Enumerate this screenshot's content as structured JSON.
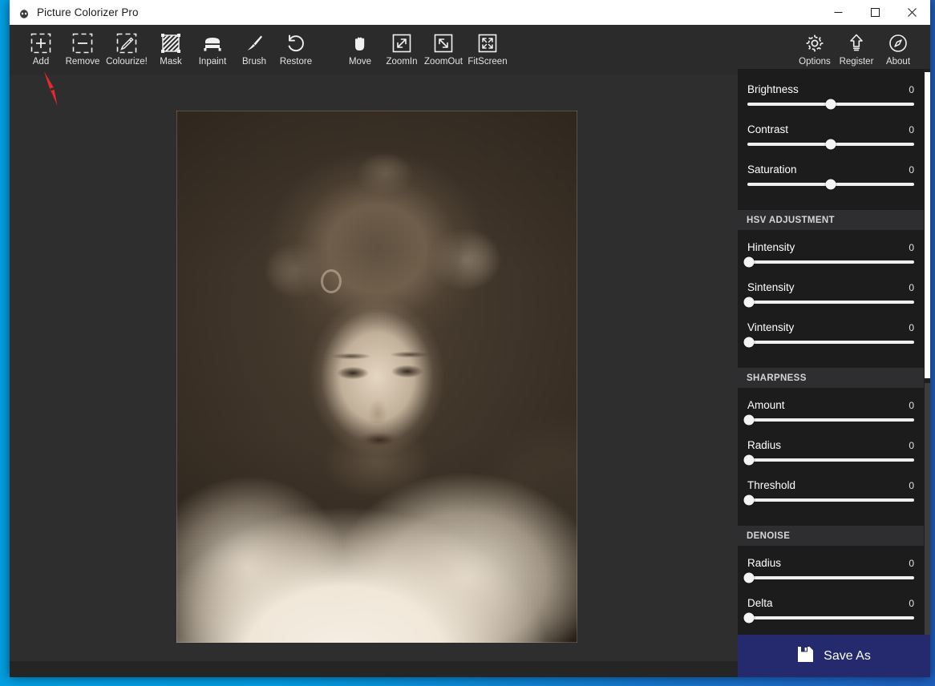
{
  "window": {
    "title": "Picture Colorizer Pro",
    "app_icon": "app-logo-icon",
    "controls": {
      "minimize": "minimize-icon",
      "maximize": "maximize-icon",
      "close": "close-icon"
    }
  },
  "toolbar": {
    "left_group": [
      {
        "label": "Add",
        "icon": "add-icon"
      },
      {
        "label": "Remove",
        "icon": "remove-icon"
      },
      {
        "label": "Colourize!",
        "icon": "colourize-icon"
      },
      {
        "label": "Mask",
        "icon": "mask-icon"
      },
      {
        "label": "Inpaint",
        "icon": "inpaint-icon"
      },
      {
        "label": "Brush",
        "icon": "brush-icon"
      },
      {
        "label": "Restore",
        "icon": "restore-icon"
      }
    ],
    "mid_group": [
      {
        "label": "Move",
        "icon": "move-hand-icon"
      },
      {
        "label": "ZoomIn",
        "icon": "zoom-in-icon"
      },
      {
        "label": "ZoomOut",
        "icon": "zoom-out-icon"
      },
      {
        "label": "FitScreen",
        "icon": "fit-screen-icon"
      }
    ],
    "right_group": [
      {
        "label": "Options",
        "icon": "gear-icon"
      },
      {
        "label": "Register",
        "icon": "register-upload-icon"
      },
      {
        "label": "About",
        "icon": "compass-icon"
      }
    ]
  },
  "canvas": {
    "image_alt": "vintage sepia portrait of a woman with curly hair and fur stole"
  },
  "panel": {
    "basic": {
      "sliders": [
        {
          "name": "Brightness",
          "value": "0",
          "thumb_pct": 50
        },
        {
          "name": "Contrast",
          "value": "0",
          "thumb_pct": 50
        },
        {
          "name": "Saturation",
          "value": "0",
          "thumb_pct": 50
        }
      ]
    },
    "sections": [
      {
        "title": "HSV ADJUSTMENT",
        "sliders": [
          {
            "name": "Hintensity",
            "value": "0",
            "thumb_pct": 0
          },
          {
            "name": "Sintensity",
            "value": "0",
            "thumb_pct": 0
          },
          {
            "name": "Vintensity",
            "value": "0",
            "thumb_pct": 0
          }
        ]
      },
      {
        "title": "SHARPNESS",
        "sliders": [
          {
            "name": "Amount",
            "value": "0",
            "thumb_pct": 0
          },
          {
            "name": "Radius",
            "value": "0",
            "thumb_pct": 0
          },
          {
            "name": "Threshold",
            "value": "0",
            "thumb_pct": 0
          }
        ]
      },
      {
        "title": "DENOISE",
        "sliders": [
          {
            "name": "Radius",
            "value": "0",
            "thumb_pct": 0
          },
          {
            "name": "Delta",
            "value": "0",
            "thumb_pct": 0
          }
        ]
      }
    ],
    "save_as": {
      "label": "Save As",
      "icon": "floppy-save-icon"
    }
  },
  "annotation": {
    "arrow_icon": "red-arrow-pointer",
    "points_at": "Add"
  },
  "colors": {
    "window_chrome": "#2b2b2b",
    "panel_bg": "#1c1c1c",
    "section_header_bg": "#2e2e31",
    "canvas_bg": "#2e2e2e",
    "save_button": "#252a6e",
    "capture_highlight": "#00a0e4",
    "annotation_red": "#e8282d",
    "slider_track": "#efefef"
  }
}
